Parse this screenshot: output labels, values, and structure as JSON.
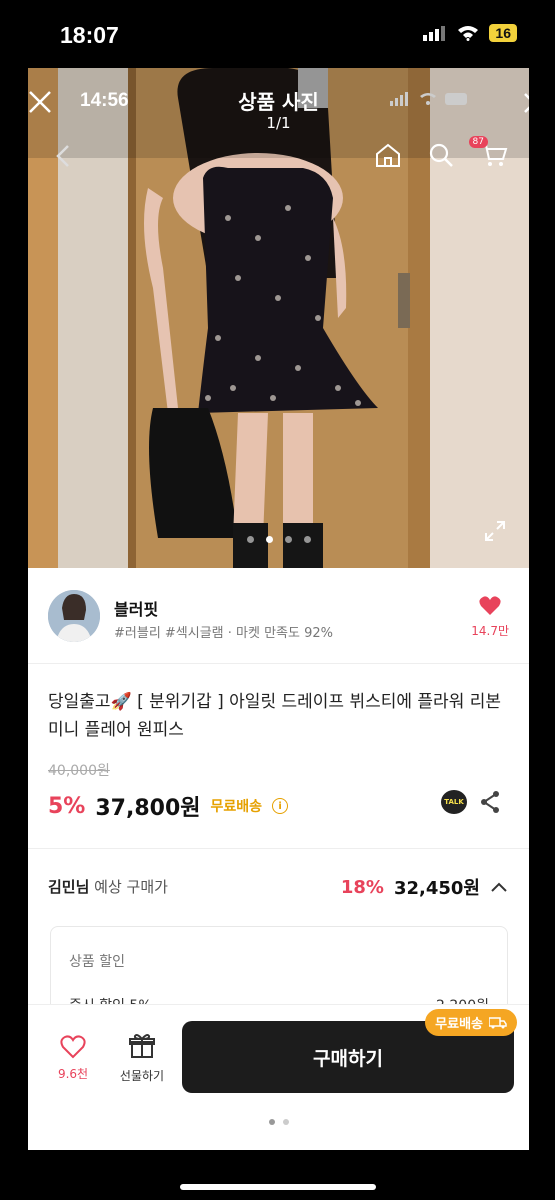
{
  "outer_status": {
    "time": "18:07",
    "battery": "16"
  },
  "photo": {
    "time": "14:56",
    "title": "상품 사진",
    "counter": "1/1",
    "cart_count": "87",
    "dots": 4
  },
  "shop": {
    "name": "블러핏",
    "tags": "#러블리 #섹시글램 · 마켓 만족도 92%",
    "likes": "14.7만"
  },
  "product": {
    "title": "당일출고🚀 [ 분위기갑 ] 아일릿 드레이프 뷔스티에 플라워 리본 미니 플레어 원피스",
    "original_price": "40,000원",
    "discount": "5%",
    "price": "37,800원",
    "shipping": "무료배송",
    "talk": "TALK"
  },
  "member": {
    "name": "김민님",
    "label": " 예상 구매가",
    "discount": "18%",
    "price": "32,450원"
  },
  "discount_box": {
    "label": "상품 할인",
    "item": "즉시 할인 5%",
    "amount": "-2,200원"
  },
  "bottom": {
    "likes": "9.6천",
    "gift_label": "선물하기",
    "buy_label": "구매하기",
    "ship_badge": "무료배송"
  },
  "colors": {
    "accent": "#e8435b",
    "shipping": "#f5a623",
    "buy_button": "#1c1c1c"
  }
}
